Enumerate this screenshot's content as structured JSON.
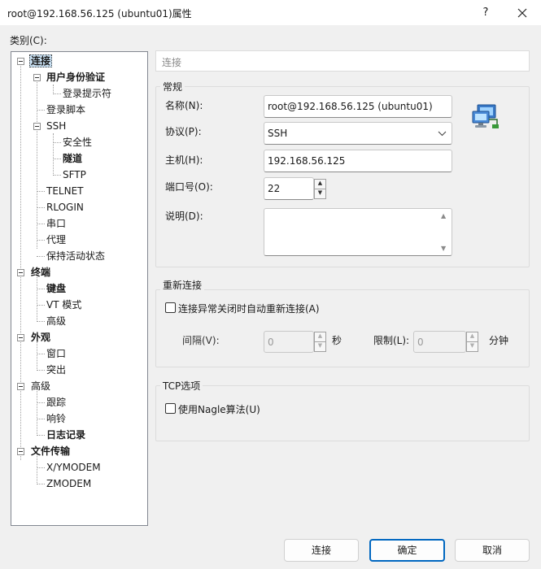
{
  "window": {
    "title": "root@192.168.56.125 (ubuntu01)属性",
    "help_label": "?"
  },
  "category_label": "类别(C):",
  "tree": {
    "items": [
      {
        "label": "连接",
        "bold": true,
        "selected": true
      },
      {
        "label": "用户身份验证",
        "bold": true
      },
      {
        "label": "登录提示符",
        "bold": false
      },
      {
        "label": "登录脚本",
        "bold": false
      },
      {
        "label": "SSH",
        "bold": false
      },
      {
        "label": "安全性",
        "bold": false
      },
      {
        "label": "隧道",
        "bold": true
      },
      {
        "label": "SFTP",
        "bold": false
      },
      {
        "label": "TELNET",
        "bold": false
      },
      {
        "label": "RLOGIN",
        "bold": false
      },
      {
        "label": "串口",
        "bold": false
      },
      {
        "label": "代理",
        "bold": false
      },
      {
        "label": "保持活动状态",
        "bold": false
      },
      {
        "label": "终端",
        "bold": true
      },
      {
        "label": "键盘",
        "bold": true
      },
      {
        "label": "VT 模式",
        "bold": false
      },
      {
        "label": "高级",
        "bold": false
      },
      {
        "label": "外观",
        "bold": true
      },
      {
        "label": "窗口",
        "bold": false
      },
      {
        "label": "突出",
        "bold": false
      },
      {
        "label": "高级",
        "bold": false
      },
      {
        "label": "跟踪",
        "bold": false
      },
      {
        "label": "响铃",
        "bold": false
      },
      {
        "label": "日志记录",
        "bold": true
      },
      {
        "label": "文件传输",
        "bold": true
      },
      {
        "label": "X/YMODEM",
        "bold": false
      },
      {
        "label": "ZMODEM",
        "bold": false
      }
    ]
  },
  "heading": "连接",
  "general": {
    "title": "常规",
    "name_label": "名称(N):",
    "name_value": "root@192.168.56.125 (ubuntu01)",
    "protocol_label": "协议(P):",
    "protocol_value": "SSH",
    "host_label": "主机(H):",
    "host_value": "192.168.56.125",
    "port_label": "端口号(O):",
    "port_value": "22",
    "desc_label": "说明(D):",
    "desc_value": ""
  },
  "reconnect": {
    "title": "重新连接",
    "auto_label": "连接异常关闭时自动重新连接(A)",
    "auto_checked": false,
    "interval_label": "间隔(V):",
    "interval_value": "0",
    "interval_unit": "秒",
    "limit_label": "限制(L):",
    "limit_value": "0",
    "limit_unit": "分钟"
  },
  "tcp": {
    "title": "TCP选项",
    "nagle_label": "使用Nagle算法(U)",
    "nagle_checked": false
  },
  "buttons": {
    "connect": "连接",
    "ok": "确定",
    "cancel": "取消"
  }
}
